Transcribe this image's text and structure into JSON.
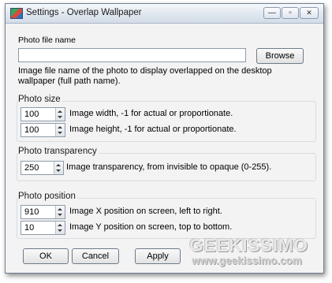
{
  "window": {
    "title": "Settings - Overlap Wallpaper",
    "controls": {
      "minimize": "—",
      "maximize": "▫",
      "close": "✕"
    }
  },
  "photo_file": {
    "label": "Photo file name",
    "value": "",
    "browse_label": "Browse",
    "description": "Image file name of the photo to display overlapped on the desktop wallpaper (full path name)."
  },
  "photo_size": {
    "title": "Photo size",
    "width_value": "100",
    "width_label": "Image width, -1 for actual or proportionate.",
    "height_value": "100",
    "height_label": "Image height, -1 for actual or proportionate."
  },
  "photo_transparency": {
    "title": "Photo transparency",
    "value": "250",
    "label": "Image transparency, from invisible to opaque (0-255)."
  },
  "photo_position": {
    "title": "Photo position",
    "x_value": "910",
    "x_label": "Image X position on screen, left to right.",
    "y_value": "10",
    "y_label": "Image Y position on screen, top to bottom."
  },
  "buttons": {
    "ok": "OK",
    "cancel": "Cancel",
    "apply": "Apply"
  },
  "watermark": {
    "brand": "GEEKISSIMO",
    "url": "www.geekissimo.com"
  }
}
